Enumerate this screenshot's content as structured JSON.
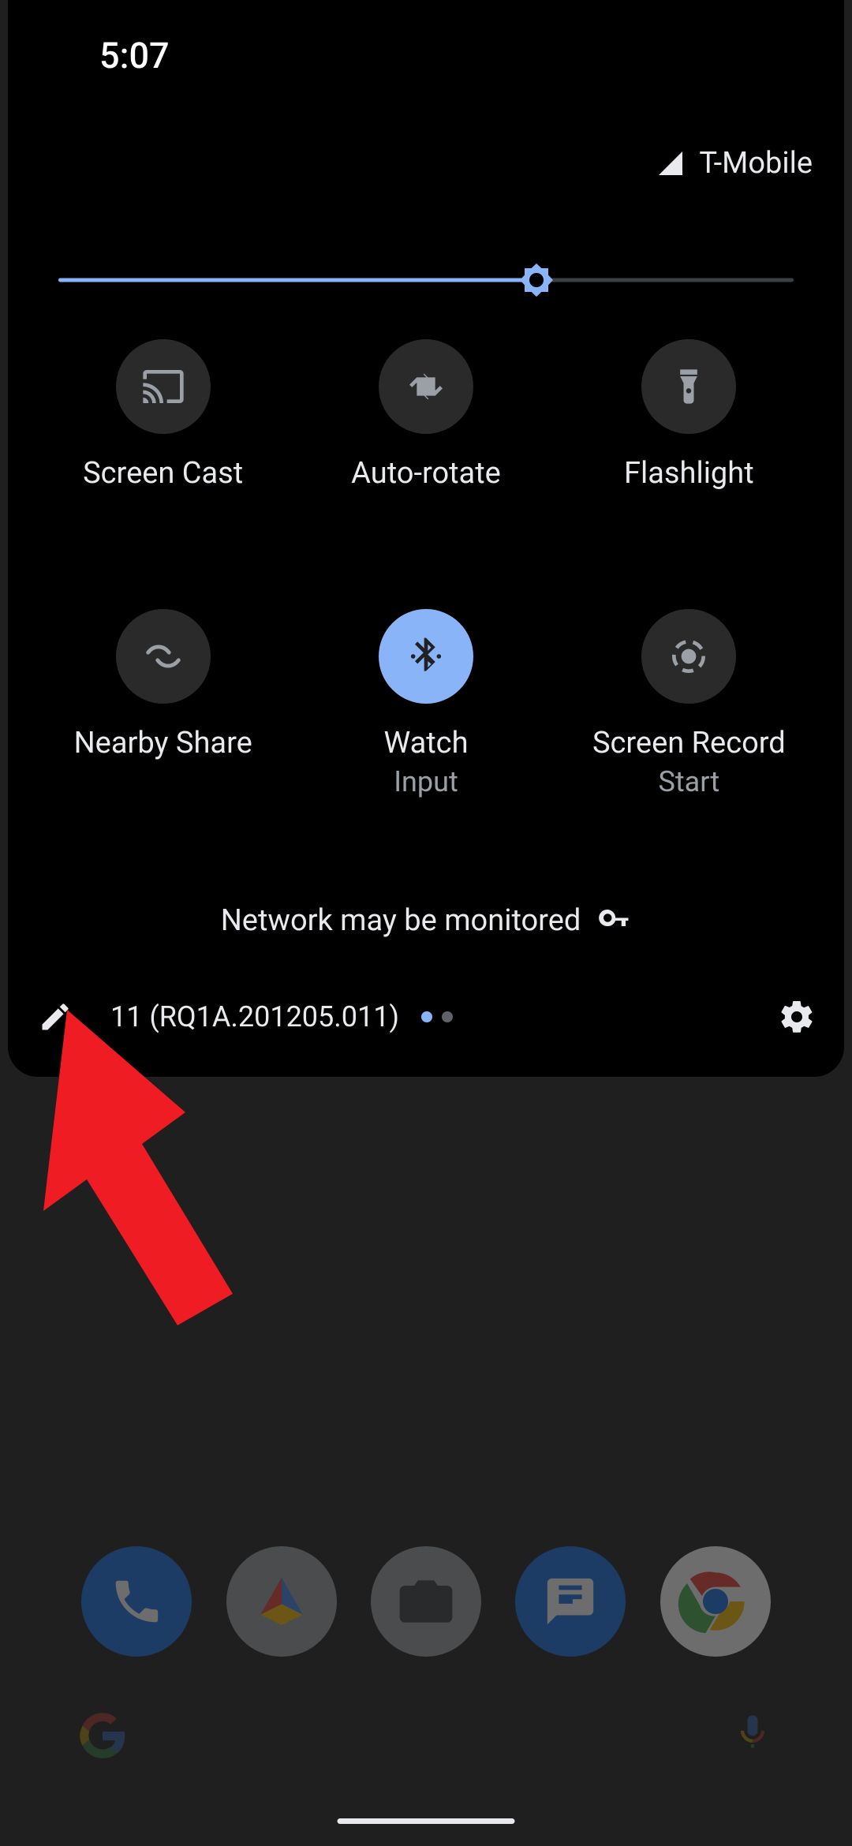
{
  "status": {
    "time": "5:07",
    "carrier": "T-Mobile"
  },
  "brightness": {
    "percent": 65
  },
  "tiles": [
    {
      "id": "screen-cast",
      "label": "Screen Cast",
      "sub": "",
      "active": false
    },
    {
      "id": "auto-rotate",
      "label": "Auto-rotate",
      "sub": "",
      "active": false
    },
    {
      "id": "flashlight",
      "label": "Flashlight",
      "sub": "",
      "active": false
    },
    {
      "id": "nearby-share",
      "label": "Nearby Share",
      "sub": "",
      "active": false
    },
    {
      "id": "bluetooth",
      "label": "Watch",
      "sub": "Input",
      "active": true
    },
    {
      "id": "screen-record",
      "label": "Screen Record",
      "sub": "Start",
      "active": false
    }
  ],
  "monitor_text": "Network may be monitored",
  "footer": {
    "build": "11 (RQ1A.201205.011)",
    "page_index": 0,
    "page_count": 2
  },
  "colors": {
    "accent": "#8ab4f8",
    "arrow": "#ef1c24"
  }
}
